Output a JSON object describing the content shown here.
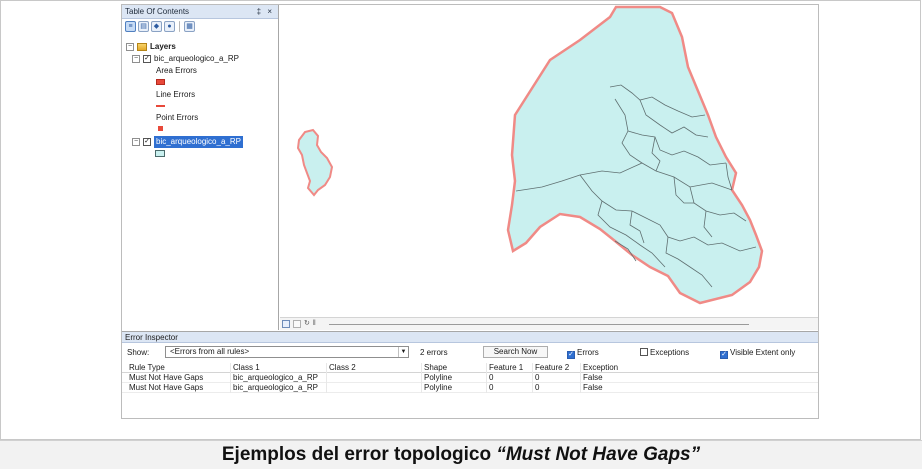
{
  "toc": {
    "title": "Table Of Contents",
    "title_buttons": "‡ ×",
    "layers_label": "Layers",
    "layer1": {
      "name": "bic_arqueologico_a_RP",
      "checked": true,
      "legend": [
        "Area Errors",
        "Line Errors",
        "Point Errors"
      ]
    },
    "layer2": {
      "name": "bic_arqueologico_a_RP",
      "checked": true,
      "selected": true
    }
  },
  "colors": {
    "error_red": "#e8493a",
    "polygon_fill": "#c9f0ef",
    "polygon_stroke": "#5f6f70",
    "gap_outline": "#f08a86",
    "selection_blue": "#2f6fd1"
  },
  "error_inspector": {
    "title": "Error Inspector",
    "show_label": "Show:",
    "show_value": "<Errors from all rules>",
    "error_count": "2 errors",
    "search_button": "Search Now",
    "errors_label": "Errors",
    "errors_checked": true,
    "exceptions_label": "Exceptions",
    "exceptions_checked": false,
    "visible_extent_label": "Visible Extent only",
    "visible_extent_checked": true,
    "columns": [
      "Rule Type",
      "Class 1",
      "Class 2",
      "Shape",
      "Feature 1",
      "Feature 2",
      "Exception"
    ],
    "rows": [
      [
        "Must Not Have Gaps",
        "bic_arqueologico_a_RP",
        "",
        "Polyline",
        "0",
        "0",
        "False"
      ],
      [
        "Must Not Have Gaps",
        "bic_arqueologico_a_RP",
        "",
        "Polyline",
        "0",
        "0",
        "False"
      ]
    ]
  },
  "caption": {
    "plain": "Ejemplos del error topologico ",
    "italic": "“Must Not Have Gaps”"
  }
}
